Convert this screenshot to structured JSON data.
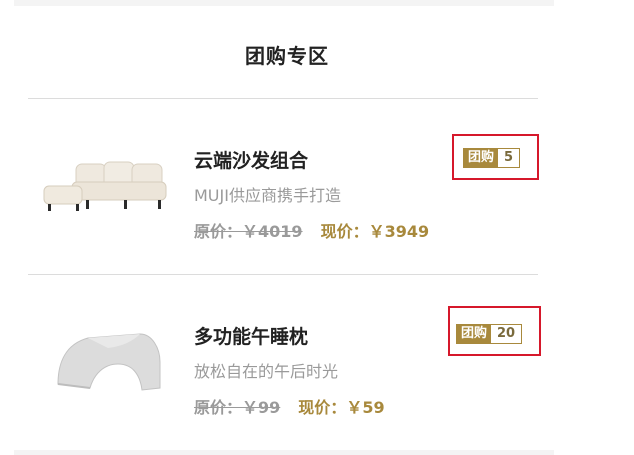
{
  "section": {
    "title": "团购专区"
  },
  "products": [
    {
      "name": "云端沙发组合",
      "desc": "MUJI供应商携手打造",
      "orig_label": "原价：",
      "orig_price": "￥4019",
      "now_label": "现价：",
      "now_price": "￥3949",
      "badge_tag": "团购",
      "badge_count": "5",
      "image": "sofa-image"
    },
    {
      "name": "多功能午睡枕",
      "desc": "放松自在的午后时光",
      "orig_label": "原价：",
      "orig_price": "￥99",
      "now_label": "现价：",
      "now_price": "￥59",
      "badge_tag": "团购",
      "badge_count": "20",
      "image": "pillow-image"
    }
  ],
  "colors": {
    "accent": "#a8893c",
    "highlight_border": "#d6182b",
    "muted": "#9a9a9a"
  }
}
